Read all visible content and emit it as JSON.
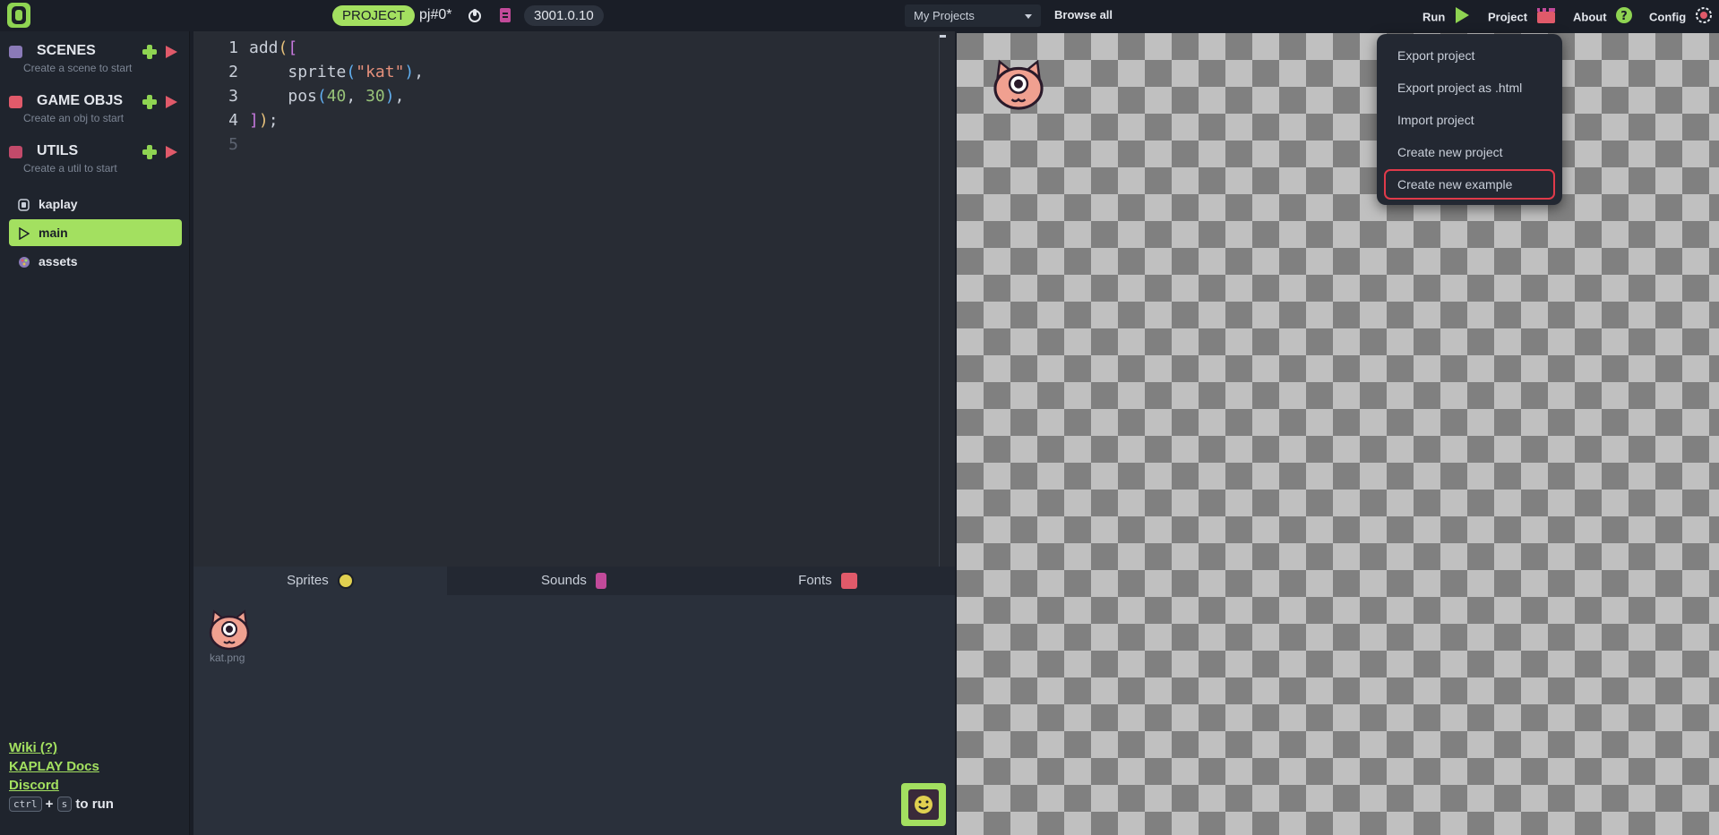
{
  "header": {
    "project_pill": "PROJECT",
    "project_id": "pj#0*",
    "version": "3001.0.10",
    "projects_select": "My Projects",
    "browse_all": "Browse all",
    "nav": {
      "run": "Run",
      "project": "Project",
      "about": "About",
      "config": "Config"
    }
  },
  "sidebar": {
    "scenes": {
      "title": "SCENES",
      "subtitle": "Create a scene to start"
    },
    "gameobjs": {
      "title": "GAME OBJS",
      "subtitle": "Create an obj to start"
    },
    "utils": {
      "title": "UTILS",
      "subtitle": "Create a util to start"
    },
    "files": [
      {
        "label": "kaplay",
        "active": false
      },
      {
        "label": "main",
        "active": true
      },
      {
        "label": "assets",
        "active": false
      }
    ],
    "links": {
      "wiki": "Wiki (?)",
      "docs": "KAPLAY Docs",
      "discord": "Discord"
    },
    "run_hint": {
      "key1": "ctrl",
      "plus": "+",
      "key2": "s",
      "text": "to run"
    }
  },
  "editor": {
    "line_numbers": [
      "1",
      "2",
      "3",
      "4",
      "5"
    ],
    "code": {
      "l1_fn": "add",
      "l1_paren": "(",
      "l1_bracket": "[",
      "l2_fn": "sprite",
      "l2_paren_open": "(",
      "l2_str": "\"kat\"",
      "l2_paren_close": ")",
      "l2_comma": ",",
      "l3_fn": "pos",
      "l3_paren_open": "(",
      "l3_num1": "40",
      "l3_sep": ", ",
      "l3_num2": "30",
      "l3_paren_close": ")",
      "l3_comma": ",",
      "l4_bracket": "]",
      "l4_paren": ")",
      "l4_semi": ";"
    }
  },
  "assets_panel": {
    "tabs": {
      "sprites": "Sprites",
      "sounds": "Sounds",
      "fonts": "Fonts"
    },
    "sprite_files": [
      "kat.png"
    ]
  },
  "project_menu": {
    "items": [
      {
        "label": "Export project"
      },
      {
        "label": "Export project as .html"
      },
      {
        "label": "Import project"
      },
      {
        "label": "Create new project"
      },
      {
        "label": "Create new example"
      }
    ]
  },
  "colors": {
    "accent_green": "#a3e060",
    "play_red": "#e05a6a",
    "highlight_red": "#e03a4a",
    "background": "#1a1e27"
  },
  "icons": {
    "scenes": "scene-clapper-icon",
    "gameobjs": "game-obj-icon",
    "utils": "util-box-icon",
    "kaplay": "kaplay-logo-icon",
    "main": "play-outline-icon",
    "assets": "assets-palette-icon"
  }
}
